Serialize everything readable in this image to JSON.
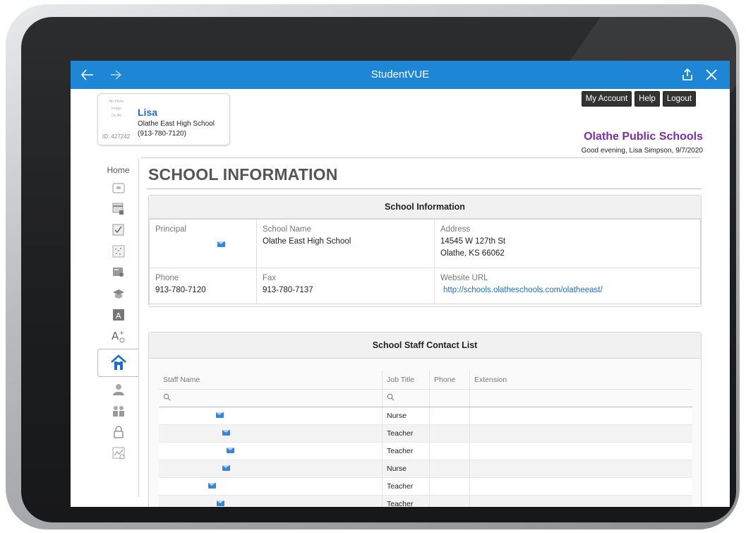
{
  "app": {
    "title": "StudentVUE"
  },
  "header": {
    "buttons": [
      "My Account",
      "Help",
      "Logout"
    ],
    "district": "Olathe Public Schools",
    "greeting": "Good evening, Lisa Simpson, 9/7/2020"
  },
  "profile": {
    "photo_text": [
      "No Photo",
      "Image",
      "On file"
    ],
    "id": "ID: 427242",
    "name": "Lisa",
    "school": "Olathe East High School",
    "phone": "(913-780-7120)"
  },
  "sidebar": {
    "home_label": "Home",
    "icons": [
      "calendar-icon",
      "gradebook-icon",
      "attendance-check-icon",
      "class-schedule-icon",
      "report-card-icon",
      "course-history-icon",
      "test-scores-icon",
      "course-request-icon",
      "school-info-icon",
      "student-info-icon",
      "contacts-icon",
      "lock-icon",
      "analytics-icon"
    ],
    "active": "school-info-icon"
  },
  "page": {
    "title": "SCHOOL INFORMATION"
  },
  "school_info": {
    "heading": "School Information",
    "principal_label": "Principal",
    "school_name_label": "School Name",
    "school_name": "Olathe East High School",
    "address_label": "Address",
    "address_line1": "14545 W 127th St",
    "address_line2": "Olathe, KS 66062",
    "phone_label": "Phone",
    "phone": "913-780-7120",
    "fax_label": "Fax",
    "fax": "913-780-7137",
    "website_label": "Website URL",
    "website": "http://schools.olatheschools.com/olatheeast/"
  },
  "staff": {
    "heading": "School Staff Contact List",
    "columns": [
      "Staff Name",
      "Job Title",
      "Phone",
      "Extension"
    ],
    "rows": [
      {
        "job": "Nurse"
      },
      {
        "job": "Teacher"
      },
      {
        "job": "Teacher"
      },
      {
        "job": "Nurse"
      },
      {
        "job": "Teacher"
      },
      {
        "job": "Teacher"
      }
    ]
  },
  "colors": {
    "titlebar": "#1e86d4",
    "district": "#7a2ea8",
    "link": "#1e6fc8",
    "mail_icon": "#3a86d6"
  }
}
